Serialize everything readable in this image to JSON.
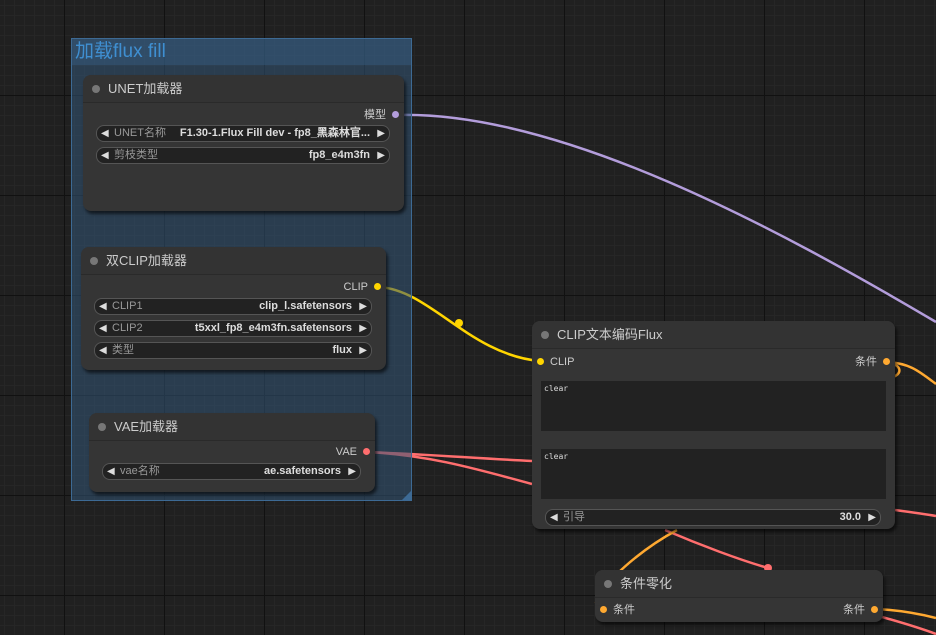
{
  "group": {
    "title": "加载flux fill"
  },
  "unet_node": {
    "title": "UNET加载器",
    "output_label": "模型",
    "widgets": [
      {
        "label": "UNET名称",
        "value": "F1.30-1.Flux Fill dev - fp8_黑森林官..."
      },
      {
        "label": "剪枝类型",
        "value": "fp8_e4m3fn"
      }
    ]
  },
  "dualclip_node": {
    "title": "双CLIP加载器",
    "output_label": "CLIP",
    "widgets": [
      {
        "label": "CLIP1",
        "value": "clip_l.safetensors"
      },
      {
        "label": "CLIP2",
        "value": "t5xxl_fp8_e4m3fn.safetensors"
      },
      {
        "label": "类型",
        "value": "flux"
      }
    ]
  },
  "vae_node": {
    "title": "VAE加载器",
    "output_label": "VAE",
    "widgets": [
      {
        "label": "vae名称",
        "value": "ae.safetensors"
      }
    ]
  },
  "clip_encode_node": {
    "title": "CLIP文本编码Flux",
    "input_label": "CLIP",
    "output_label": "条件",
    "text1": "clear",
    "text2": "clear",
    "widgets": [
      {
        "label": "引导",
        "value": "30.0"
      }
    ]
  },
  "cond_zero_node": {
    "title": "条件零化",
    "input_label": "条件",
    "output_label": "条件"
  },
  "colors": {
    "model": "#b39ddb",
    "clip": "#ffd500",
    "vae": "#ff6e6e",
    "conditioning": "#ffa931",
    "group_title": "#3f8fd1"
  }
}
